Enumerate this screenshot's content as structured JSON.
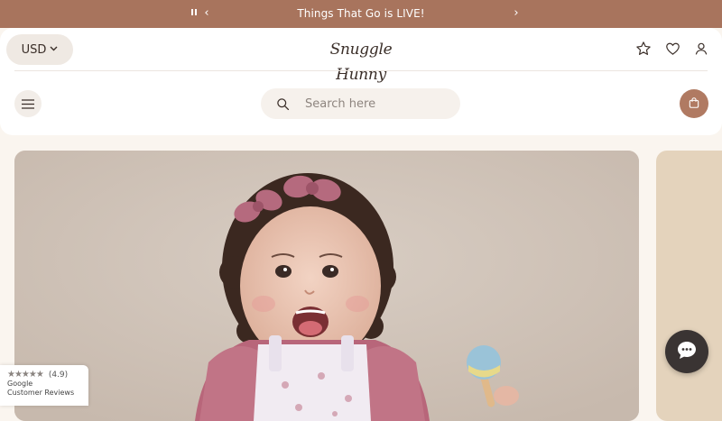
{
  "announcement": {
    "message": "Things That Go is LIVE!",
    "prev_glyph": "‹",
    "next_glyph": "›"
  },
  "header": {
    "currency": "USD",
    "currency_caret": "⌄",
    "logo_text": "Snuggle Hunny",
    "search_placeholder": "Search here"
  },
  "reviews_badge": {
    "stars": "★★★★★",
    "rating": "(4.9)",
    "source_line1": "Google",
    "source_line2": "Customer Reviews"
  },
  "colors": {
    "announcement_bg": "#a8745d",
    "accent": "#b07a62",
    "page_bg": "#faf5ef",
    "chat_bg": "#3a3433"
  },
  "icons": {
    "header_right": [
      "star-icon",
      "heart-icon",
      "user-icon"
    ],
    "menu": "hamburger-icon",
    "search": "search-icon",
    "cart": "shopping-bag-icon",
    "chat": "chat-bubble-icon"
  }
}
